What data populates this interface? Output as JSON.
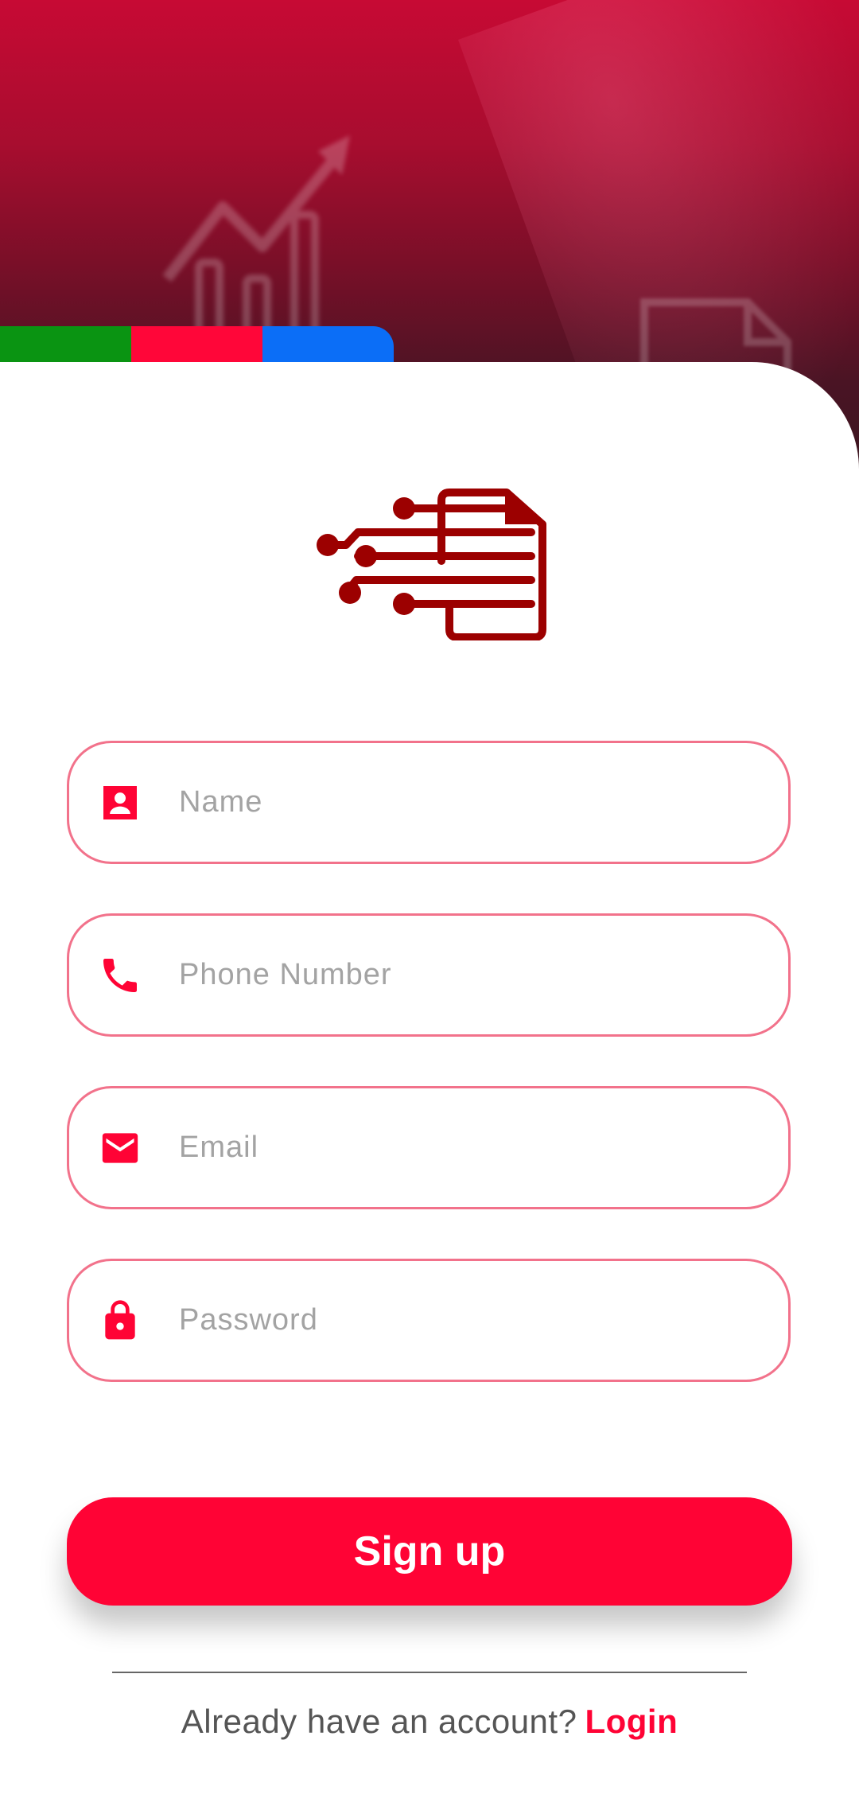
{
  "header": {
    "flag_colors": [
      "#0a9412",
      "#ff0639",
      "#0b6ef7"
    ]
  },
  "logo": {
    "icon": "circuit-document-icon",
    "color": "#9c0000"
  },
  "form": {
    "accent": "#f2728b",
    "icon_color": "#ff0335",
    "fields": {
      "name": {
        "placeholder": "Name",
        "icon": "contact-card-icon"
      },
      "phone": {
        "placeholder": "Phone Number",
        "icon": "phone-icon"
      },
      "email": {
        "placeholder": "Email",
        "icon": "mail-icon"
      },
      "password": {
        "placeholder": "Password",
        "icon": "lock-icon"
      }
    }
  },
  "actions": {
    "signup_label": "Sign up",
    "button_color": "#ff0335"
  },
  "footer": {
    "prompt": "Already have an account?",
    "login_label": "Login"
  }
}
